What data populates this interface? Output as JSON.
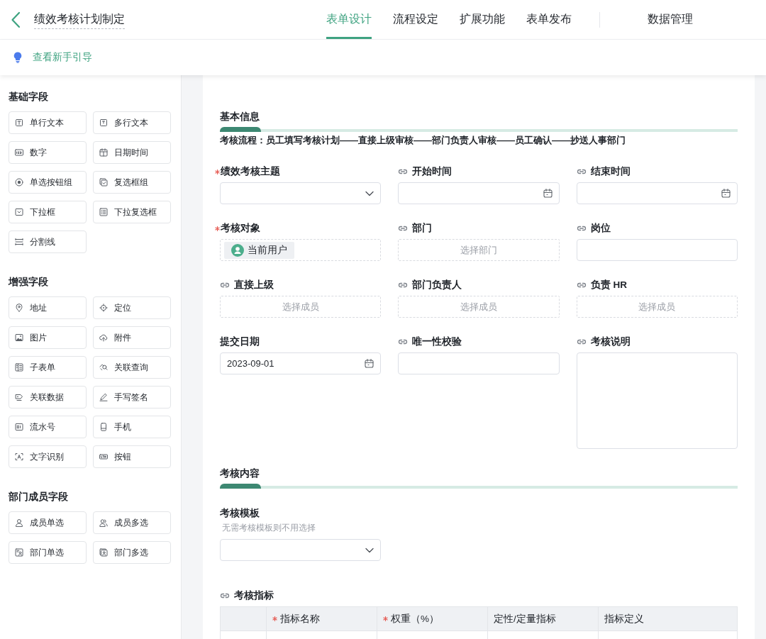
{
  "header": {
    "title": "绩效考核计划制定",
    "tabs": [
      {
        "label": "表单设计",
        "selected": true
      },
      {
        "label": "流程设定",
        "selected": false
      },
      {
        "label": "扩展功能",
        "selected": false
      },
      {
        "label": "表单发布",
        "selected": false
      }
    ],
    "more_tabs": [
      {
        "label": "数据管理",
        "selected": false
      }
    ]
  },
  "guide_link": "查看新手引导",
  "sidebar": {
    "groups": [
      {
        "title": "基础字段",
        "items": [
          {
            "label": "单行文本",
            "kind": "text"
          },
          {
            "label": "多行文本",
            "kind": "textarea"
          },
          {
            "label": "数字",
            "kind": "number"
          },
          {
            "label": "日期时间",
            "kind": "datetime"
          },
          {
            "label": "单选按钮组",
            "kind": "radio"
          },
          {
            "label": "复选框组",
            "kind": "checkbox"
          },
          {
            "label": "下拉框",
            "kind": "select"
          },
          {
            "label": "下拉复选框",
            "kind": "multiselect"
          },
          {
            "label": "分割线",
            "kind": "divider"
          }
        ]
      },
      {
        "title": "增强字段",
        "items": [
          {
            "label": "地址",
            "kind": "address"
          },
          {
            "label": "定位",
            "kind": "location"
          },
          {
            "label": "图片",
            "kind": "image"
          },
          {
            "label": "附件",
            "kind": "attachment"
          },
          {
            "label": "子表单",
            "kind": "subform"
          },
          {
            "label": "关联查询",
            "kind": "lookup"
          },
          {
            "label": "关联数据",
            "kind": "linked"
          },
          {
            "label": "手写签名",
            "kind": "signature"
          },
          {
            "label": "流水号",
            "kind": "serial"
          },
          {
            "label": "手机",
            "kind": "phone"
          },
          {
            "label": "文字识别",
            "kind": "ocr"
          },
          {
            "label": "按钮",
            "kind": "button"
          }
        ]
      },
      {
        "title": "部门成员字段",
        "items": [
          {
            "label": "成员单选",
            "kind": "user"
          },
          {
            "label": "成员多选",
            "kind": "users"
          },
          {
            "label": "部门单选",
            "kind": "dept"
          },
          {
            "label": "部门多选",
            "kind": "depts"
          }
        ]
      }
    ]
  },
  "form": {
    "sections": [
      {
        "title": "基本信息",
        "note": "考核流程：员工填写考核计划——直接上级审核——部门负责人审核——员工确认——抄送人事部门",
        "fields": [
          {
            "label": "绩效考核主题",
            "required": true,
            "linked": false,
            "kind": "select"
          },
          {
            "label": "开始时间",
            "required": false,
            "linked": true,
            "kind": "date"
          },
          {
            "label": "结束时间",
            "required": false,
            "linked": true,
            "kind": "date"
          },
          {
            "label": "考核对象",
            "required": true,
            "linked": false,
            "kind": "member",
            "value": "当前用户"
          },
          {
            "label": "部门",
            "required": false,
            "linked": true,
            "kind": "picker",
            "placeholder": "选择部门"
          },
          {
            "label": "岗位",
            "required": false,
            "linked": true,
            "kind": "text"
          },
          {
            "label": "直接上级",
            "required": false,
            "linked": true,
            "kind": "picker",
            "placeholder": "选择成员"
          },
          {
            "label": "部门负责人",
            "required": false,
            "linked": true,
            "kind": "picker",
            "placeholder": "选择成员"
          },
          {
            "label": "负责 HR",
            "required": false,
            "linked": true,
            "kind": "picker",
            "placeholder": "选择成员"
          },
          {
            "label": "提交日期",
            "required": false,
            "linked": false,
            "kind": "date",
            "value": "2023-09-01"
          },
          {
            "label": "唯一性校验",
            "required": false,
            "linked": true,
            "kind": "text"
          },
          {
            "label": "考核说明",
            "required": false,
            "linked": true,
            "kind": "textarea"
          }
        ]
      },
      {
        "title": "考核内容",
        "fields": [
          {
            "label": "考核模板",
            "required": false,
            "linked": false,
            "kind": "select",
            "hint": "无需考核模板则不用选择"
          }
        ],
        "table": {
          "label": "考核指标",
          "linked": true,
          "columns": [
            {
              "label": "指标名称",
              "required": true
            },
            {
              "label": "权重（%）",
              "required": true
            },
            {
              "label": "定性/定量指标",
              "required": false
            },
            {
              "label": "指标定义",
              "required": false
            }
          ]
        }
      }
    ]
  }
}
